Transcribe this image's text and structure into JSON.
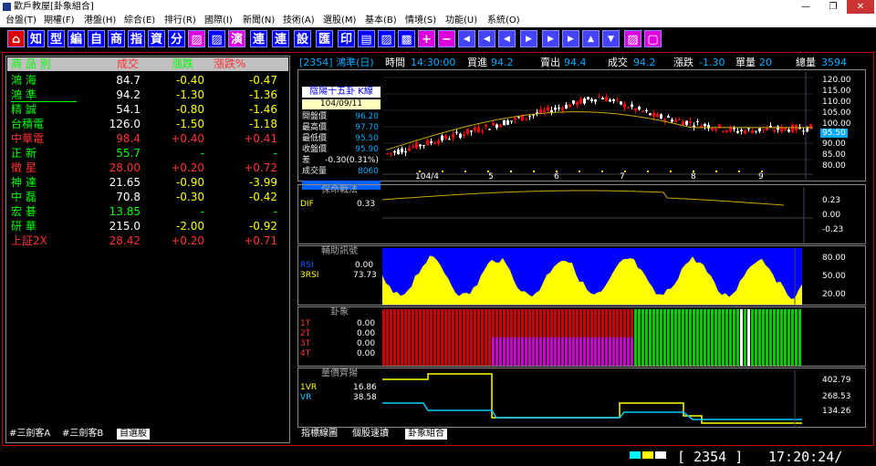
{
  "window": {
    "title": "歡戶教屋[卦象組合]",
    "min": "—",
    "max": "❐",
    "close": "✕"
  },
  "menu": [
    "台盤(T)",
    "期權(F)",
    "港盤(H)",
    "綜合(E)",
    "排行(R)",
    "國際(I)",
    "新聞(N)",
    "技術(A)",
    "選股(M)",
    "基本(B)",
    "情境(S)",
    "功能(U)",
    "系統(O)"
  ],
  "toolbar": [
    "知",
    "型",
    "編",
    "自",
    "商",
    "指",
    "資",
    "分",
    "▨",
    "▨",
    "演",
    "連",
    "連",
    "設",
    "匯",
    "印",
    "▤",
    "▨",
    "▩",
    "+",
    "−",
    "◀",
    "◀",
    "◀",
    "▶",
    "▶",
    "▶",
    "▲",
    "▼",
    "▨",
    "▢"
  ],
  "quotes": {
    "headers": {
      "name": "商 品 別",
      "price": "成交",
      "change": "漲跌",
      "pct": "漲跌%"
    },
    "rows": [
      {
        "name": "鴻 海",
        "price": "84.7",
        "change": "-0.40",
        "pct": "-0.47",
        "name_color": "#00ff00",
        "val_color": "#ffffff",
        "chg_color": "#ffff00"
      },
      {
        "name": "鴻 準",
        "price": "94.2",
        "change": "-1.30",
        "pct": "-1.36",
        "name_color": "#00ff00",
        "val_color": "#ffffff",
        "chg_color": "#ffff00"
      },
      {
        "name": "精 誠",
        "price": "54.1",
        "change": "-0.80",
        "pct": "-1.46",
        "name_color": "#00ff00",
        "val_color": "#ffffff",
        "chg_color": "#ffff00"
      },
      {
        "name": "台積電",
        "price": "126.0",
        "change": "-1.50",
        "pct": "-1.18",
        "name_color": "#00ff00",
        "val_color": "#ffffff",
        "chg_color": "#ffff00"
      },
      {
        "name": "中華電",
        "price": "98.4",
        "change": "+0.40",
        "pct": "+0.41",
        "name_color": "#ff3333",
        "val_color": "#ff3333",
        "chg_color": "#ff3333"
      },
      {
        "name": "正 新",
        "price": "55.7",
        "change": "-",
        "pct": "-",
        "name_color": "#00ff00",
        "val_color": "#00ff00",
        "chg_color": "#00ff00"
      },
      {
        "name": "徵 星",
        "price": "28.00",
        "change": "+0.20",
        "pct": "+0.72",
        "name_color": "#ff3333",
        "val_color": "#ff3333",
        "chg_color": "#ff3333"
      },
      {
        "name": "神 達",
        "price": "21.65",
        "change": "-0.90",
        "pct": "-3.99",
        "name_color": "#00ff00",
        "val_color": "#ffffff",
        "chg_color": "#ffff00"
      },
      {
        "name": "中 磊",
        "price": "70.8",
        "change": "-0.30",
        "pct": "-0.42",
        "name_color": "#00ff00",
        "val_color": "#ffffff",
        "chg_color": "#ffff00"
      },
      {
        "name": "宏 碁",
        "price": "13.85",
        "change": "-",
        "pct": "-",
        "name_color": "#00ff00",
        "val_color": "#00ff00",
        "chg_color": "#00ff00"
      },
      {
        "name": "研 華",
        "price": "215.0",
        "change": "-2.00",
        "pct": "-0.92",
        "name_color": "#00ff00",
        "val_color": "#ffffff",
        "chg_color": "#ffff00"
      },
      {
        "name": "上証2X",
        "price": "28.42",
        "change": "+0.20",
        "pct": "+0.71",
        "name_color": "#ff3333",
        "val_color": "#ff3333",
        "chg_color": "#ff3333"
      }
    ]
  },
  "left_tabs": [
    "#三劍客A",
    "#三劍客B",
    "自選股"
  ],
  "info_bar": {
    "code": "[2354] 鴻準(日)",
    "time_label": "時間",
    "time": "14:30:00",
    "buy_label": "買進",
    "buy": "94.2",
    "sell_label": "賣出",
    "sell": "94.4",
    "deal_label": "成交",
    "deal": "94.2",
    "chg_label": "漲跌",
    "chg": "-1.30",
    "vol_label": "單量",
    "vol": "20",
    "total_label": "總量",
    "total": "3594"
  },
  "kline": {
    "title": "陰陽十五卦 K線",
    "date": "104/09/11",
    "open_label": "開盤價",
    "open": "96.20",
    "high_label": "最高價",
    "high": "97.70",
    "low_label": "最低價",
    "low": "95.50",
    "close_label": "收盤價",
    "close": "95.90",
    "diff_label": "差",
    "diff": "-0.30(0.31%)",
    "volume_label": "成交量",
    "volume": "8060",
    "y_ticks": [
      "120.00",
      "115.00",
      "110.00",
      "105.00",
      "100.00",
      "95.50",
      "90.00",
      "85.00",
      "80.00"
    ],
    "x_ticks": [
      "104/4",
      "5",
      "6",
      "7",
      "8",
      "9"
    ],
    "current_price": "95.50"
  },
  "dif_panel": {
    "title": "保命戰法",
    "legend_label": "DIF",
    "legend_value": "0.33",
    "y_ticks": [
      "0.23",
      "0.00",
      "-0.23"
    ]
  },
  "rsi_panel": {
    "title": "輔助訊號",
    "l1_label": "RSI",
    "l1_value": "0.00",
    "l2_label": "3RSI",
    "l2_value": "73.73",
    "y_ticks": [
      "80.00",
      "50.00",
      "20.00"
    ]
  },
  "gua_panel": {
    "title": "卦象",
    "rows": [
      {
        "label": "1T",
        "value": "0.00"
      },
      {
        "label": "2T",
        "value": "0.00"
      },
      {
        "label": "3T",
        "value": "0.00"
      },
      {
        "label": "4T",
        "value": "0.00"
      }
    ]
  },
  "vr_panel": {
    "title": "量價齊揚",
    "l1_label": "1VR",
    "l1_value": "16.86",
    "l2_label": "VR",
    "l2_value": "38.58",
    "y_ticks": [
      "402.79",
      "268.53",
      "134.26"
    ]
  },
  "right_tabs": [
    "指標線圖",
    "個股速讀",
    "卦象組合"
  ],
  "status": {
    "code": "[ 2354  ]",
    "time": "17:20:24/"
  },
  "colors": {
    "up": "#ff0000",
    "down": "#00ff00",
    "accent": "#ffff00",
    "blue": "#0000ff"
  }
}
